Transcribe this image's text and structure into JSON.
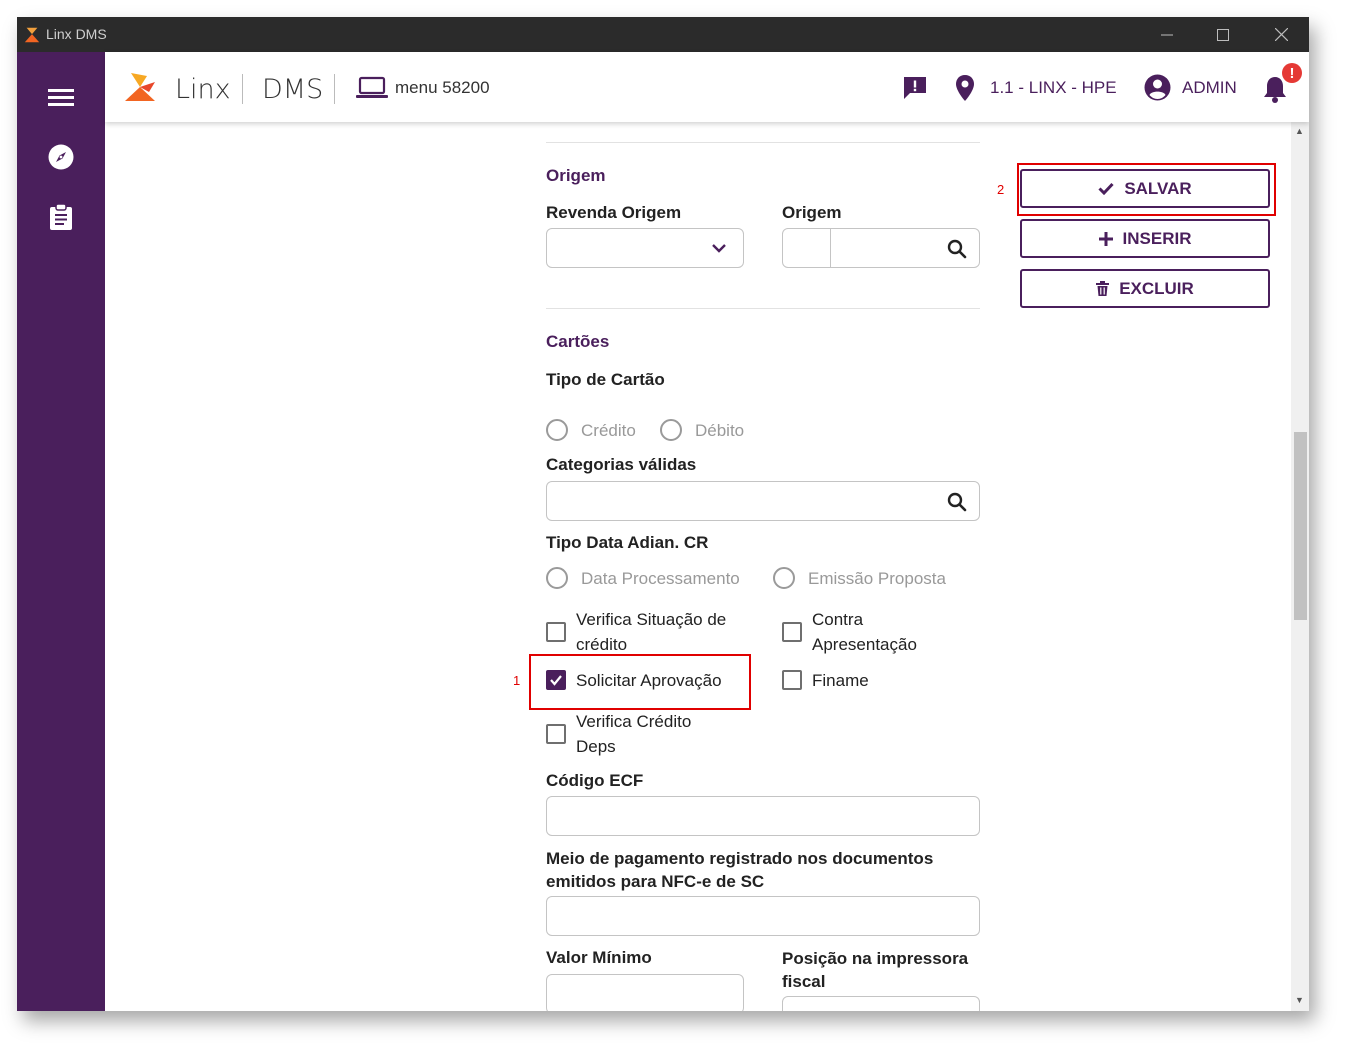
{
  "window": {
    "title": "Linx DMS"
  },
  "header": {
    "brand_linx": "Linx",
    "brand_dms": "DMS",
    "menu_label": "menu 58200",
    "location": "1.1 - LINX - HPE",
    "user": "ADMIN",
    "notification_badge": "!"
  },
  "colors": {
    "brand_purple": "#4a1f5c",
    "annotation_red": "#e00000",
    "logo_orange": "#f26522"
  },
  "origem": {
    "section_title": "Origem",
    "revenda_label": "Revenda Origem",
    "revenda_value": "",
    "origem_label": "Origem",
    "origem_code": "",
    "origem_desc": ""
  },
  "cartoes": {
    "section_title": "Cartões",
    "tipo_label": "Tipo de Cartão",
    "tipo_options": [
      "Crédito",
      "Débito"
    ],
    "categorias_label": "Categorias válidas",
    "categorias_value": "",
    "tipo_data_label": "Tipo Data Adian. CR",
    "tipo_data_options": [
      "Data Processamento",
      "Emissão Proposta"
    ],
    "checkboxes": {
      "verifica_situacao": {
        "label": "Verifica Situação de crédito",
        "checked": false
      },
      "contra_apresentacao": {
        "label": "Contra Apresentação",
        "checked": false
      },
      "solicitar_aprovacao": {
        "label": "Solicitar Aprovação",
        "checked": true
      },
      "finame": {
        "label": "Finame",
        "checked": false
      },
      "verifica_credito_deps": {
        "label": "Verifica Crédito Deps",
        "checked": false
      }
    },
    "codigo_ecf_label": "Código ECF",
    "meio_pagamento_label": "Meio de pagamento registrado nos documentos emitidos para NFC-e de SC",
    "valor_minimo_label": "Valor Mínimo",
    "posicao_label": "Posição na impressora fiscal"
  },
  "actions": {
    "salvar": "SALVAR",
    "inserir": "INSERIR",
    "excluir": "EXCLUIR"
  },
  "annotations": {
    "mark1": "1",
    "mark2": "2"
  }
}
